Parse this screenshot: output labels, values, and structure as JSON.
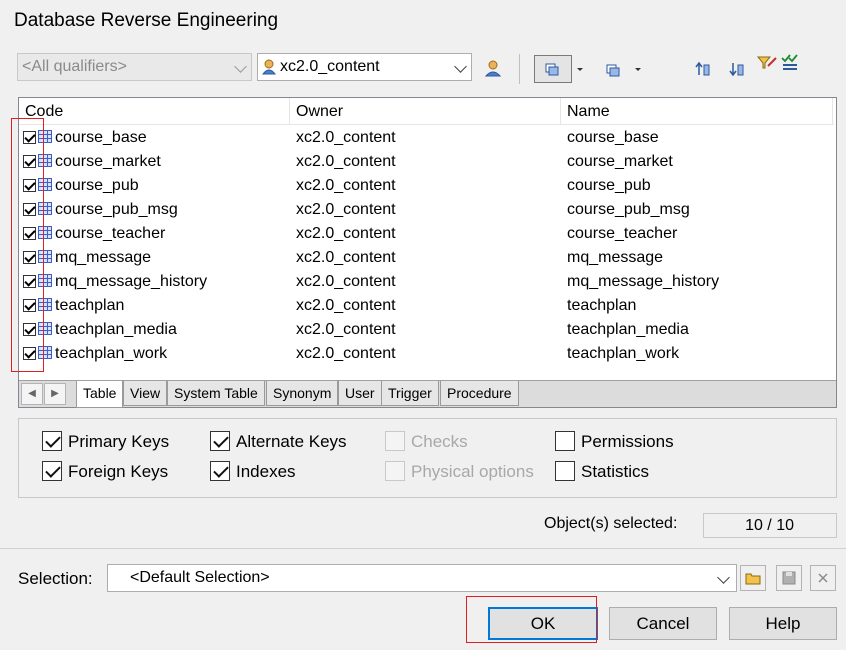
{
  "dialog": {
    "title": "Database Reverse Engineering"
  },
  "qualifier": {
    "value": "<All qualifiers>"
  },
  "owner": {
    "value": "xc2.0_content"
  },
  "toolbar": {
    "icons": [
      "owner-icon",
      "select-all-icon",
      "deselect-all-icon",
      "move-up-icon",
      "move-down-icon",
      "filter-icon",
      "check-all-icon"
    ]
  },
  "grid": {
    "columns": [
      "Code",
      "Owner",
      "Name"
    ],
    "rows": [
      {
        "code": "course_base",
        "owner": "xc2.0_content",
        "name": "course_base",
        "checked": true
      },
      {
        "code": "course_market",
        "owner": "xc2.0_content",
        "name": "course_market",
        "checked": true
      },
      {
        "code": "course_pub",
        "owner": "xc2.0_content",
        "name": "course_pub",
        "checked": true
      },
      {
        "code": "course_pub_msg",
        "owner": "xc2.0_content",
        "name": "course_pub_msg",
        "checked": true
      },
      {
        "code": "course_teacher",
        "owner": "xc2.0_content",
        "name": "course_teacher",
        "checked": true
      },
      {
        "code": "mq_message",
        "owner": "xc2.0_content",
        "name": "mq_message",
        "checked": true
      },
      {
        "code": "mq_message_history",
        "owner": "xc2.0_content",
        "name": "mq_message_history",
        "checked": true
      },
      {
        "code": "teachplan",
        "owner": "xc2.0_content",
        "name": "teachplan",
        "checked": true
      },
      {
        "code": "teachplan_media",
        "owner": "xc2.0_content",
        "name": "teachplan_media",
        "checked": true
      },
      {
        "code": "teachplan_work",
        "owner": "xc2.0_content",
        "name": "teachplan_work",
        "checked": true
      }
    ],
    "tabs": [
      "Table",
      "View",
      "System Table",
      "Synonym",
      "User",
      "Trigger",
      "Procedure"
    ]
  },
  "options": {
    "primary_keys": "Primary Keys",
    "foreign_keys": "Foreign Keys",
    "alternate_keys": "Alternate Keys",
    "indexes": "Indexes",
    "checks": "Checks",
    "physical_options": "Physical options",
    "permissions": "Permissions",
    "statistics": "Statistics"
  },
  "summary": {
    "label": "Object(s) selected:",
    "value": "10 / 10"
  },
  "selection": {
    "label": "Selection:",
    "value": "<Default Selection>"
  },
  "buttons": {
    "ok": "OK",
    "cancel": "Cancel",
    "help": "Help"
  }
}
